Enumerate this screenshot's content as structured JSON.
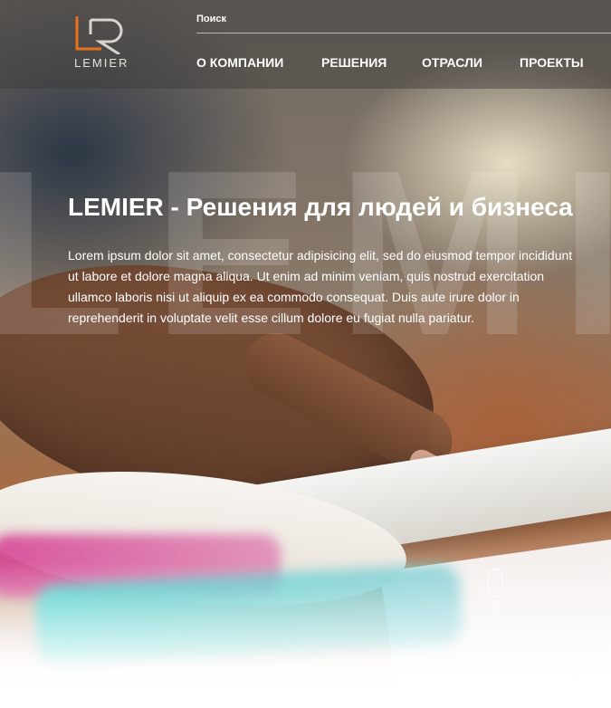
{
  "brand": {
    "name": "LEMIER",
    "accent_color": "#e8721c",
    "logo_icon": "lr-monogram-icon"
  },
  "header": {
    "search_label": "Поиск",
    "nav": [
      {
        "label": "О КОМПАНИИ"
      },
      {
        "label": "РЕШЕНИЯ"
      },
      {
        "label": "ОТРАСЛИ"
      },
      {
        "label": "ПРОЕКТЫ"
      }
    ]
  },
  "hero": {
    "background_letters": "LEMIER",
    "title": "LEMIER - Решения для людей и бизнеса",
    "text": "Lorem ipsum dolor sit amet, consectetur adipisicing elit, sed do eiusmod tempor incididunt ut labore et dolore magna aliqua. Ut enim ad minim veniam, quis nostrud exercitation ullamco laboris nisi ut aliquip ex ea commodo consequat. Duis aute irure dolor in reprehenderit in voluptate velit esse cillum dolore eu fugiat nulla pariatur.",
    "scroll_icon": "mouse-scroll-down-icon"
  }
}
